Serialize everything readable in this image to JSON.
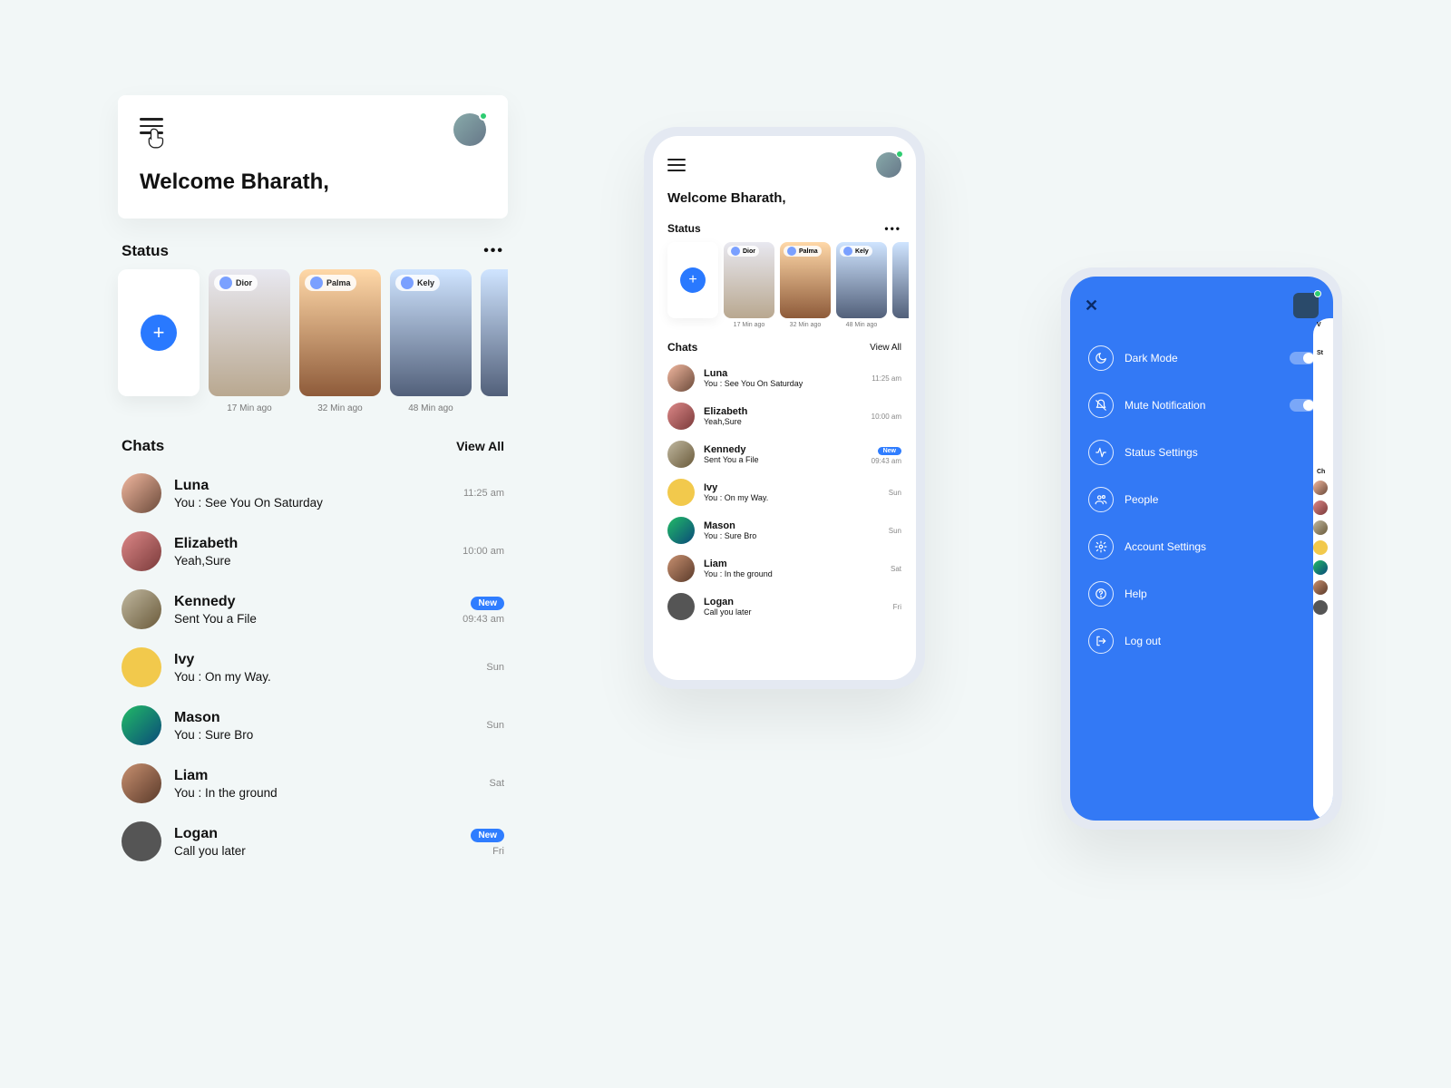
{
  "welcome": "Welcome  Bharath,",
  "status": {
    "heading": "Status",
    "cards": [
      {
        "name": "Dior",
        "time": "17 Min ago"
      },
      {
        "name": "Palma",
        "time": "32 Min ago"
      },
      {
        "name": "Kely",
        "time": "48 Min ago"
      }
    ]
  },
  "chats": {
    "heading": "Chats",
    "view_all": "View All",
    "new_badge": "New",
    "items": [
      {
        "name": "Luna",
        "preview": "You : See You On Saturday",
        "time": "11:25 am",
        "badge": false
      },
      {
        "name": "Elizabeth",
        "preview": "Yeah,Sure",
        "time": "10:00 am",
        "badge": false
      },
      {
        "name": "Kennedy",
        "preview": "Sent You a File",
        "time": "09:43 am",
        "badge": true
      },
      {
        "name": "Ivy",
        "preview": "You : On my Way.",
        "time": "Sun",
        "badge": false
      },
      {
        "name": "Mason",
        "preview": "You : Sure Bro",
        "time": "Sun",
        "badge": false
      },
      {
        "name": "Liam",
        "preview": "You : In the ground",
        "time": "Sat",
        "badge": false
      },
      {
        "name": "Logan",
        "preview": "Call you later",
        "time": "Fri",
        "badge": true
      }
    ]
  },
  "phone2": {
    "chats_extra_time": "09:43 am"
  },
  "drawer": {
    "items": [
      {
        "label": "Dark Mode",
        "icon": "moon",
        "toggle": true
      },
      {
        "label": "Mute Notification",
        "icon": "bell-off",
        "toggle": true
      },
      {
        "label": "Status Settings",
        "icon": "activity",
        "toggle": false
      },
      {
        "label": "People",
        "icon": "people",
        "toggle": false
      },
      {
        "label": "Account Settings",
        "icon": "gear",
        "toggle": false
      },
      {
        "label": "Help",
        "icon": "help",
        "toggle": false
      },
      {
        "label": "Log out",
        "icon": "logout",
        "toggle": false
      }
    ]
  },
  "peek": {
    "letters": [
      "V",
      "St",
      "Ch"
    ]
  }
}
